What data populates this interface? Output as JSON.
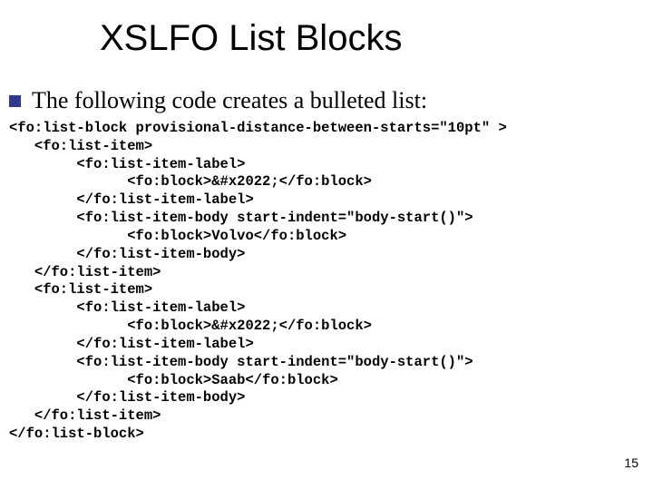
{
  "title": "XSLFO List Blocks",
  "bullet_text": "The following code creates a bulleted list:",
  "code": "<fo:list-block provisional-distance-between-starts=\"10pt\" >\n   <fo:list-item>\n        <fo:list-item-label>\n              <fo:block>&#x2022;</fo:block>\n        </fo:list-item-label>\n        <fo:list-item-body start-indent=\"body-start()\">\n              <fo:block>Volvo</fo:block>\n        </fo:list-item-body>\n   </fo:list-item>\n   <fo:list-item>\n        <fo:list-item-label>\n              <fo:block>&#x2022;</fo:block>\n        </fo:list-item-label>\n        <fo:list-item-body start-indent=\"body-start()\">\n              <fo:block>Saab</fo:block>\n        </fo:list-item-body>\n   </fo:list-item>\n</fo:list-block>",
  "page_number": "15"
}
